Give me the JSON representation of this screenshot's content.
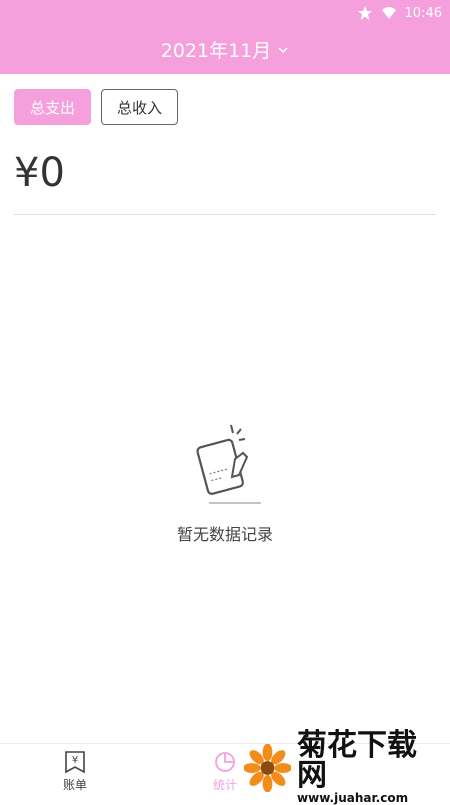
{
  "status": {
    "time": "10:46"
  },
  "header": {
    "month_label": "2021年11月"
  },
  "tabs": [
    {
      "label": "总支出"
    },
    {
      "label": "总收入"
    }
  ],
  "summary": {
    "amount": "¥0"
  },
  "empty_state": {
    "text": "暂无数据记录"
  },
  "bottom_nav": [
    {
      "label": "账单",
      "icon": "bill-icon"
    },
    {
      "label": "统计",
      "icon": "pie-chart-icon"
    }
  ],
  "watermark": {
    "title": "菊花下载网",
    "url": "www.juahar.com"
  },
  "colors": {
    "accent": "#f5a0dc",
    "text": "#333333",
    "divider": "#dedede"
  }
}
